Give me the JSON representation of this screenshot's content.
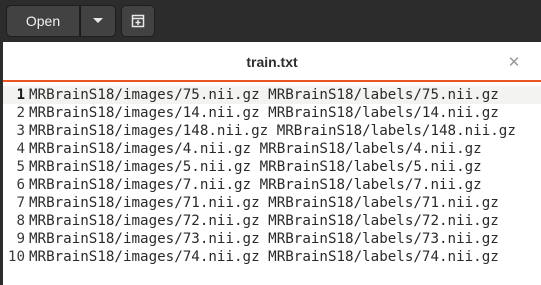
{
  "toolbar": {
    "open_label": "Open",
    "open_menu_icon": "chevron-down-icon",
    "new_document_icon": "new-document-icon"
  },
  "tab": {
    "title": "train.txt",
    "close_icon": "close-icon"
  },
  "colors": {
    "headerbar": "#2c2c2c",
    "button": "#424242",
    "accent": "#e95420",
    "editor_bg": "#ffffff",
    "current_line_bg": "#f3f3f1"
  },
  "lines": [
    {
      "num": "1",
      "text": "MRBrainS18/images/75.nii.gz MRBrainS18/labels/75.nii.gz"
    },
    {
      "num": "2",
      "text": "MRBrainS18/images/14.nii.gz MRBrainS18/labels/14.nii.gz"
    },
    {
      "num": "3",
      "text": "MRBrainS18/images/148.nii.gz MRBrainS18/labels/148.nii.gz"
    },
    {
      "num": "4",
      "text": "MRBrainS18/images/4.nii.gz MRBrainS18/labels/4.nii.gz"
    },
    {
      "num": "5",
      "text": "MRBrainS18/images/5.nii.gz MRBrainS18/labels/5.nii.gz"
    },
    {
      "num": "6",
      "text": "MRBrainS18/images/7.nii.gz MRBrainS18/labels/7.nii.gz"
    },
    {
      "num": "7",
      "text": "MRBrainS18/images/71.nii.gz MRBrainS18/labels/71.nii.gz"
    },
    {
      "num": "8",
      "text": "MRBrainS18/images/72.nii.gz MRBrainS18/labels/72.nii.gz"
    },
    {
      "num": "9",
      "text": "MRBrainS18/images/73.nii.gz MRBrainS18/labels/73.nii.gz"
    },
    {
      "num": "10",
      "text": "MRBrainS18/images/74.nii.gz MRBrainS18/labels/74.nii.gz"
    }
  ]
}
